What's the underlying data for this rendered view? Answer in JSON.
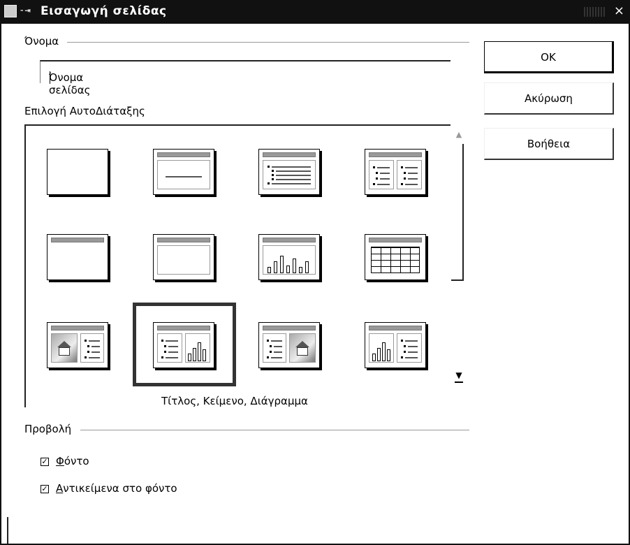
{
  "window": {
    "title": "Εισαγωγή σελίδας",
    "pin_glyph": "-⇥",
    "close_glyph": "×"
  },
  "name_section": {
    "label": "Όνομα",
    "value": "Όνομα σελίδας"
  },
  "autolayout": {
    "label": "Επιλογή ΑυτοΔιάταξης",
    "selected_caption": "Τίτλος, Κείμενο, Διάγραμμα"
  },
  "view_section": {
    "label": "Προβολή",
    "options": [
      {
        "accesskey": "Φ",
        "rest": "όντο",
        "checked": true
      },
      {
        "accesskey": "Α",
        "rest": "ντικείμενα στο φόντο",
        "checked": true
      }
    ],
    "check_glyph": "✓"
  },
  "buttons": {
    "ok": "OK",
    "cancel": "Ακύρωση",
    "help": "Βοήθεια"
  },
  "scrollbar": {
    "up_glyph": "▲",
    "down_glyph": "▼"
  },
  "icons": [
    "app-icon",
    "pin-icon",
    "close-icon",
    "scroll-up-icon",
    "scroll-down-icon",
    "checkbox-icon"
  ]
}
